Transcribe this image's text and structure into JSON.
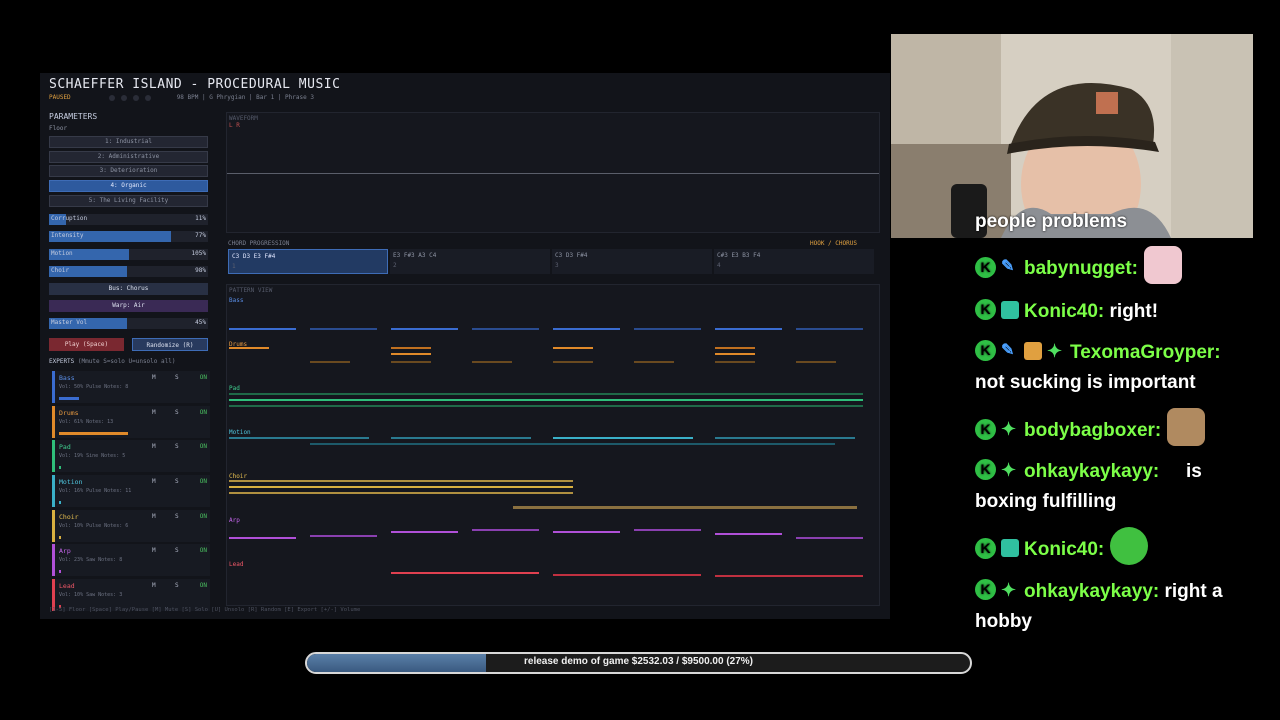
{
  "app": {
    "title": "SCHAEFFER ISLAND - PROCEDURAL MUSIC",
    "status": "PAUSED",
    "info": "98 BPM  |  G Phrygian  |  Bar 1  |  Phrase 3"
  },
  "parameters": {
    "heading": "PARAMETERS",
    "floor_label": "Floor",
    "floors": [
      "1: Industrial",
      "2: Administrative",
      "3: Deterioration",
      "4: Organic",
      "5: The Living Facility"
    ],
    "active_floor": 3,
    "sliders": [
      {
        "label": "Corruption",
        "value": "11%",
        "level": 0.11
      },
      {
        "label": "Intensity",
        "value": "77%",
        "level": 0.77
      },
      {
        "label": "Motion",
        "value": "105%",
        "level": 0.5
      },
      {
        "label": "Choir",
        "value": "98%",
        "level": 0.49
      }
    ],
    "bus_chorus": "Bus: Chorus",
    "warp": "Warp: Air",
    "master": {
      "label": "Master Vol",
      "value": "45%",
      "level": 0.49
    },
    "play_button": "Play (Space)",
    "randomize_button": "Randomize (R)"
  },
  "mixer": {
    "heading": "EXPERTS",
    "hint": "(Mmute  S=solo  U=unsolo all)",
    "tracks": [
      {
        "name": "Bass",
        "info": "Vol: 50%  Pulse  Notes: 8",
        "color": "#3a6cd0",
        "vol": 0.25
      },
      {
        "name": "Drums",
        "info": "Vol: 61%  Notes: 13",
        "color": "#e08a2a",
        "vol": 0.54
      },
      {
        "name": "Pad",
        "info": "Vol: 19%  Sine  Notes: 5",
        "color": "#2fbf7a",
        "vol": 0.01
      },
      {
        "name": "Motion",
        "info": "Vol: 16%  Pulse  Notes: 11",
        "color": "#3ab0c8",
        "vol": 0.01
      },
      {
        "name": "Choir",
        "info": "Vol: 10%  Pulse  Notes: 6",
        "color": "#d8b040",
        "vol": 0.01
      },
      {
        "name": "Arp",
        "info": "Vol: 23%  Saw  Notes: 8",
        "color": "#b050d8",
        "vol": 0.01
      },
      {
        "name": "Lead",
        "info": "Vol: 10%  Saw  Notes: 3",
        "color": "#e04050",
        "vol": 0.01
      }
    ],
    "m": "M",
    "s": "S",
    "on": "ON"
  },
  "waveform": {
    "heading": "WAVEFORM",
    "channels": "L R"
  },
  "chords": {
    "heading": "CHORD PROGRESSION",
    "section": "HOOK / CHORUS",
    "items": [
      {
        "name": "C3 D3 E3 F#4",
        "index": "1"
      },
      {
        "name": "E3 F#3 A3 C4",
        "index": "2"
      },
      {
        "name": "C3 D3 F#4",
        "index": "3"
      },
      {
        "name": "C#3 E3 B3 F4",
        "index": "4"
      }
    ]
  },
  "pattern": {
    "heading": "PATTERN VIEW",
    "lanes": [
      "Bass",
      "Drums",
      "Pad",
      "Motion",
      "Choir",
      "Arp",
      "Lead"
    ]
  },
  "footer": "[1-5] Floor  [Space] Play/Pause  [M] Mute  [S] Solo  [U] Unsolo  [R] Random  [E] Export  [+/-] Volume",
  "chat": {
    "partial": "people problems",
    "messages": [
      {
        "user": "babynugget:",
        "text": ""
      },
      {
        "user": "Konic40:",
        "text": "right!"
      },
      {
        "user": "TexomaGroyper:",
        "text": "not sucking is important"
      },
      {
        "user": "bodybagboxer:",
        "text": ""
      },
      {
        "user": "ohkaykaykayy:",
        "text": "is boxing fulfilling"
      },
      {
        "user": "Konic40:",
        "text": ""
      },
      {
        "user": "ohkaykaykayy:",
        "text": "right a hobby"
      }
    ]
  },
  "goal": {
    "text": "release demo of game $2532.03 / $9500.00 (27%)",
    "progress": 0.27
  }
}
